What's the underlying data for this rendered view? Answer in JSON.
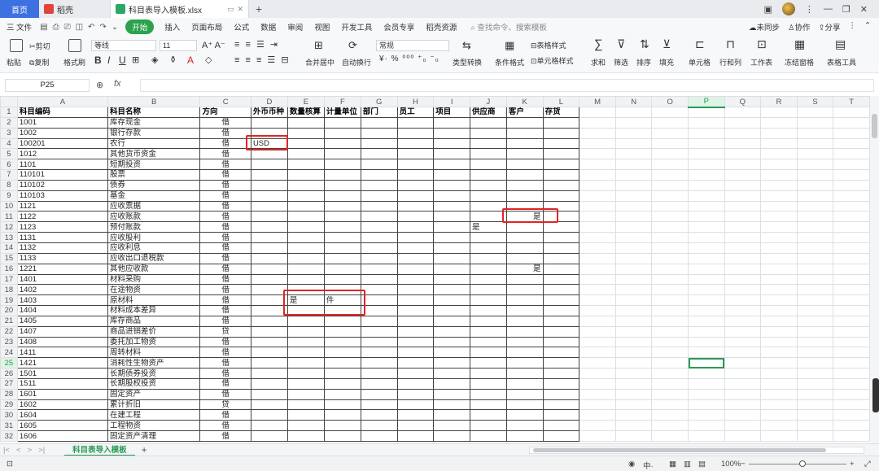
{
  "tabs": {
    "home": "首页",
    "app": "稻壳",
    "file": "科目表导入模板.xlsx",
    "add": "+"
  },
  "menu": {
    "file": "三 文件",
    "start": "开始",
    "items": [
      "插入",
      "页面布局",
      "公式",
      "数据",
      "审阅",
      "视图",
      "开发工具",
      "会员专享",
      "稻壳资源"
    ],
    "search": "查找命令、搜索模板",
    "right": [
      "未同步",
      "协作",
      "分享"
    ]
  },
  "ribbon": {
    "paste": "粘贴",
    "cut": "剪切",
    "copy": "复制",
    "format_painter": "格式刷",
    "font": "等线",
    "font_size": "11",
    "merge": "合并居中",
    "wrap": "自动换行",
    "number_format": "常规",
    "type_convert": "类型转换",
    "cond_format": "条件格式",
    "table_style": "表格样式",
    "cell_style": "单元格样式",
    "sum": "求和",
    "filter": "筛选",
    "sort": "排序",
    "fill": "填充",
    "cell": "单元格",
    "rowcol": "行和列",
    "worksheet": "工作表",
    "freeze": "冻结窗格",
    "table_tools": "表格工具"
  },
  "formula_bar": {
    "name_box": "P25",
    "fx": "fx",
    "formula": ""
  },
  "columns": [
    "A",
    "B",
    "C",
    "D",
    "E",
    "F",
    "G",
    "H",
    "I",
    "J",
    "K",
    "L",
    "M",
    "N",
    "O",
    "P",
    "Q",
    "R",
    "S",
    "T"
  ],
  "selected_column": "P",
  "selected_row": 25,
  "header_row": [
    "科目编码",
    "科目名称",
    "方向",
    "外币币种",
    "数量核算",
    "计量单位",
    "部门",
    "员工",
    "项目",
    "供应商",
    "客户",
    "存货"
  ],
  "rows": [
    {
      "code": "1001",
      "name": "库存现金",
      "dir": "借"
    },
    {
      "code": "1002",
      "name": "银行存款",
      "dir": "借"
    },
    {
      "code": "100201",
      "name": "农行",
      "dir": "借",
      "currency": "USD"
    },
    {
      "code": "1012",
      "name": "其他货币资金",
      "dir": "借"
    },
    {
      "code": "1101",
      "name": "短期投资",
      "dir": "借"
    },
    {
      "code": "110101",
      "name": "股票",
      "dir": "借"
    },
    {
      "code": "110102",
      "name": "债券",
      "dir": "借"
    },
    {
      "code": "110103",
      "name": "基金",
      "dir": "借"
    },
    {
      "code": "1121",
      "name": "应收票据",
      "dir": "借"
    },
    {
      "code": "1122",
      "name": "应收账款",
      "dir": "借",
      "customer": "是"
    },
    {
      "code": "1123",
      "name": "预付账款",
      "dir": "借",
      "supplier": "是"
    },
    {
      "code": "1131",
      "name": "应收股利",
      "dir": "借"
    },
    {
      "code": "1132",
      "name": "应收利息",
      "dir": "借"
    },
    {
      "code": "1133",
      "name": "应收出口退税款",
      "dir": "借"
    },
    {
      "code": "1221",
      "name": "其他应收款",
      "dir": "借",
      "customer": "是"
    },
    {
      "code": "1401",
      "name": "材料采购",
      "dir": "借"
    },
    {
      "code": "1402",
      "name": "在途物资",
      "dir": "借"
    },
    {
      "code": "1403",
      "name": "原材料",
      "dir": "借",
      "qty": "是",
      "unit": "件"
    },
    {
      "code": "1404",
      "name": "材料成本差异",
      "dir": "借"
    },
    {
      "code": "1405",
      "name": "库存商品",
      "dir": "借"
    },
    {
      "code": "1407",
      "name": "商品进销差价",
      "dir": "贷"
    },
    {
      "code": "1408",
      "name": "委托加工物资",
      "dir": "借"
    },
    {
      "code": "1411",
      "name": "周转材料",
      "dir": "借"
    },
    {
      "code": "1421",
      "name": "消耗性生物资产",
      "dir": "借"
    },
    {
      "code": "1501",
      "name": "长期债券投资",
      "dir": "借"
    },
    {
      "code": "1511",
      "name": "长期股权投资",
      "dir": "借"
    },
    {
      "code": "1601",
      "name": "固定资产",
      "dir": "借"
    },
    {
      "code": "1602",
      "name": "累计折旧",
      "dir": "贷"
    },
    {
      "code": "1604",
      "name": "在建工程",
      "dir": "借"
    },
    {
      "code": "1605",
      "name": "工程物资",
      "dir": "借"
    },
    {
      "code": "1606",
      "name": "固定资产清理",
      "dir": "借"
    }
  ],
  "sheet_tab": "科目表导入模板",
  "status": {
    "zoom": "100%"
  }
}
